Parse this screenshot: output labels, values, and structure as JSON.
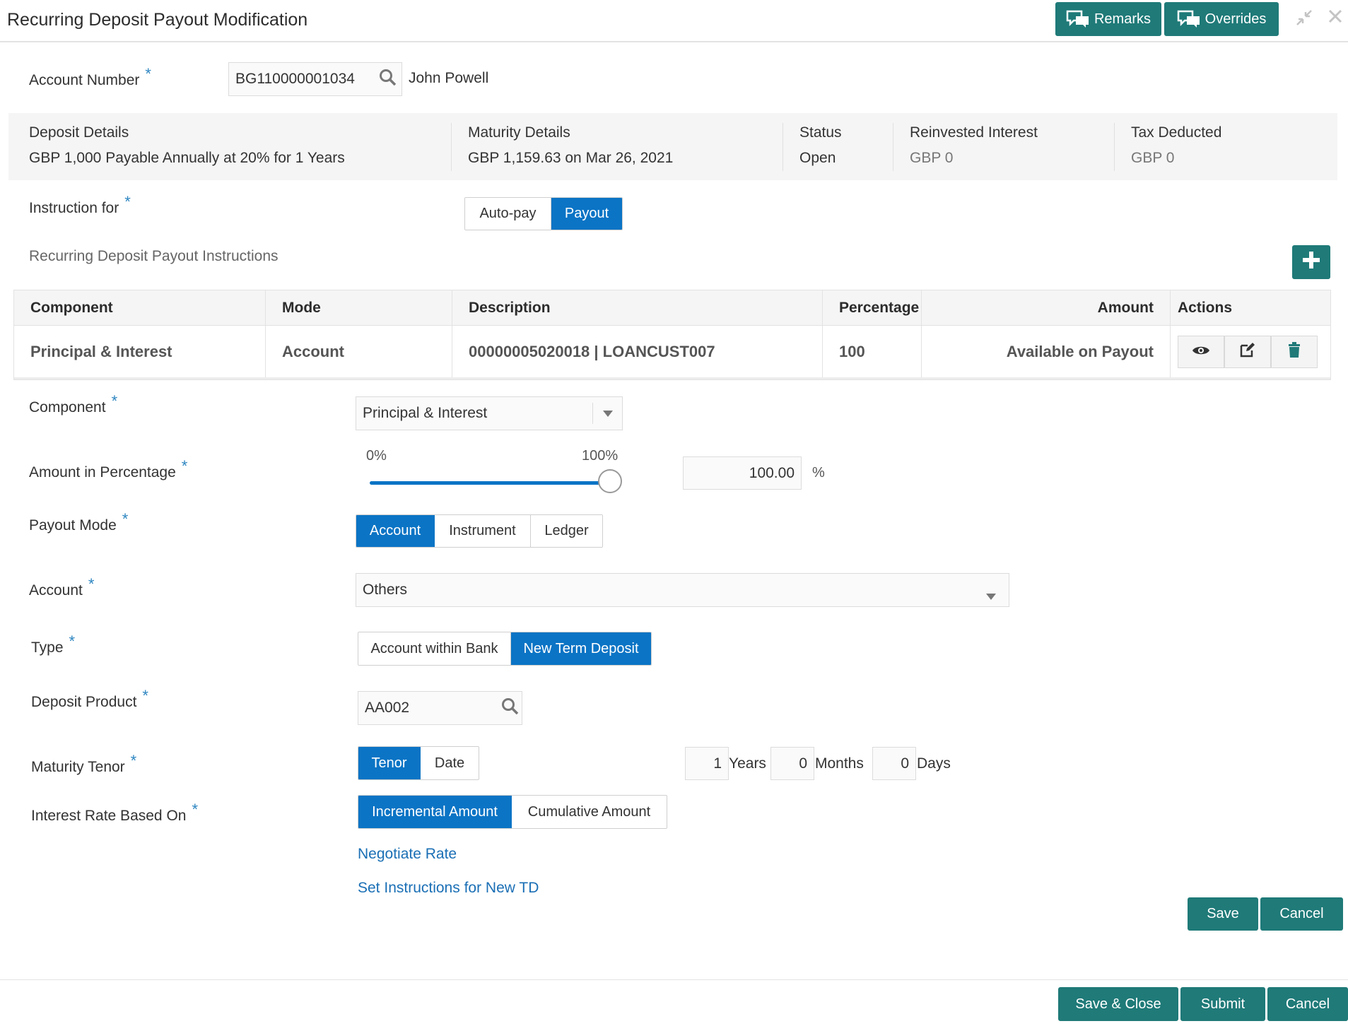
{
  "header": {
    "title": "Recurring Deposit Payout Modification",
    "remarks_label": "Remarks",
    "overrides_label": "Overrides"
  },
  "account": {
    "label": "Account Number",
    "value": "BG110000001034",
    "holder": "John Powell"
  },
  "summary": {
    "deposit_details_label": "Deposit Details",
    "deposit_details_value": "GBP 1,000 Payable Annually at 20% for 1 Years",
    "maturity_details_label": "Maturity Details",
    "maturity_details_value": "GBP 1,159.63 on Mar 26, 2021",
    "status_label": "Status",
    "status_value": "Open",
    "reinvested_interest_label": "Reinvested Interest",
    "reinvested_interest_value": "GBP 0",
    "tax_deducted_label": "Tax Deducted",
    "tax_deducted_value": "GBP 0"
  },
  "instruction_for": {
    "label": "Instruction for",
    "options": [
      "Auto-pay",
      "Payout"
    ],
    "selected": "Payout"
  },
  "instructions": {
    "section_title": "Recurring Deposit Payout Instructions",
    "columns": [
      "Component",
      "Mode",
      "Description",
      "Percentage",
      "Amount",
      "Actions"
    ],
    "rows": [
      {
        "component": "Principal & Interest",
        "mode": "Account",
        "description": "00000005020018 | LOANCUST007",
        "percentage": "100",
        "amount": "Available on Payout"
      }
    ]
  },
  "form": {
    "component_label": "Component",
    "component_value": "Principal & Interest",
    "amount_pct_label": "Amount in Percentage",
    "slider_min": "0%",
    "slider_max": "100%",
    "slider_level": 1.0,
    "amount_pct_value": "100.00",
    "pct_symbol": "%",
    "payout_mode_label": "Payout Mode",
    "payout_mode_options": [
      "Account",
      "Instrument",
      "Ledger"
    ],
    "payout_mode_selected": "Account",
    "account_label": "Account",
    "account_value": "Others",
    "type_label": "Type",
    "type_options": [
      "Account within Bank",
      "New Term Deposit"
    ],
    "type_selected": "New Term Deposit",
    "deposit_product_label": "Deposit Product",
    "deposit_product_value": "AA002",
    "maturity_tenor_label": "Maturity Tenor",
    "tenor_options": [
      "Tenor",
      "Date"
    ],
    "tenor_selected": "Tenor",
    "years_value": "1",
    "years_label": "Years",
    "months_value": "0",
    "months_label": "Months",
    "days_value": "0",
    "days_label": "Days",
    "interest_rate_label": "Interest Rate Based On",
    "interest_rate_options": [
      "Incremental Amount",
      "Cumulative Amount"
    ],
    "interest_rate_selected": "Incremental Amount",
    "negotiate_rate_link": "Negotiate Rate",
    "set_instructions_link": "Set Instructions for New TD",
    "save_label": "Save",
    "cancel_label": "Cancel"
  },
  "footer": {
    "save_close_label": "Save & Close",
    "submit_label": "Submit",
    "cancel_label": "Cancel"
  },
  "colors": {
    "teal": "#1f7a78",
    "selected_blue": "#0b74c5",
    "required_star": "#2e86c1",
    "link": "#1a6fb5"
  },
  "required_star": "*"
}
